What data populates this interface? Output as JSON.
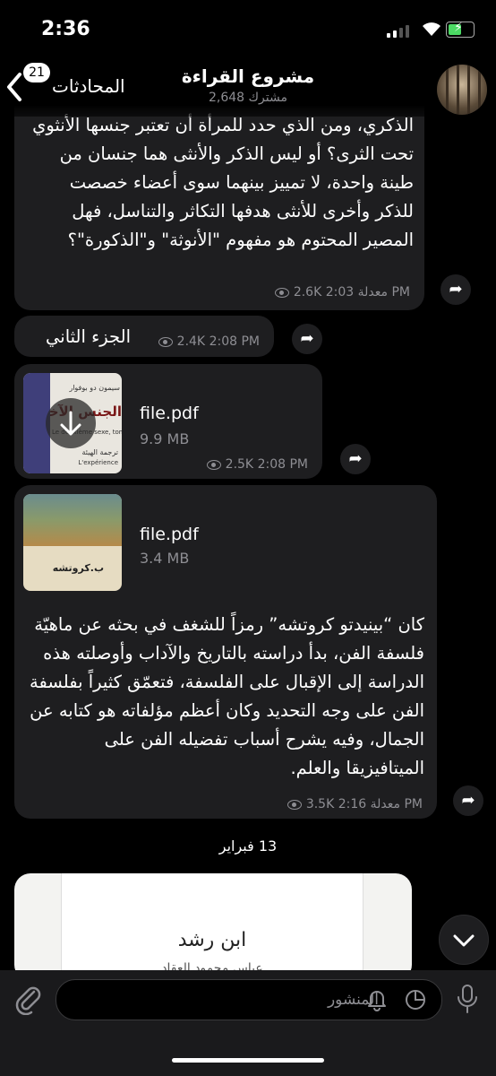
{
  "status": {
    "time": "2:36"
  },
  "header": {
    "back_label": "المحادثات",
    "unread_count": "21",
    "title": "مشروع القراءة",
    "subscribers": "2,648 مشترك"
  },
  "messages": [
    {
      "text": "الذكري، ومن الذي حدد للمرأة أن تعتبر جنسها الأنثوي تحت الثرى؟ أو ليس الذكر والأنثى هما جنسان من طينة واحدة، لا تمييز بينهما سوى أعضاء خصصت للذكر وأخرى للأنثى هدفها التكاثر والتناسل، فهل المصير المحتوم هو مفهوم \"الأنوثة\" و\"الذكورة\"؟",
      "views": "2.6K",
      "time": "2:03 PM",
      "edited": "معدلة"
    },
    {
      "text": "الجزء الثاني",
      "views": "2.4K",
      "time": "2:08 PM"
    },
    {
      "file_name": "file.pdf",
      "file_size": "9.9 MB",
      "views": "2.5K",
      "time": "2:08 PM",
      "cover_title": "الجنس الآخر",
      "cover_author": "سيمون دو بوفوار",
      "cover_subtitle": "Le deuxième sexe, tome",
      "cover_line2": "ترجمة الهيئة",
      "cover_line3": "L'expérience"
    },
    {
      "file_name": "file.pdf",
      "file_size": "3.4 MB",
      "cover_title": "ب.كروتشه",
      "text": "كان “بينيدتو كروتشه” رمزاً للشغف في بحثه عن ماهيّة فلسفة الفن، بدأ دراسته بالتاريخ والآداب وأوصلته هذه الدراسة إلى الإقبال على الفلسفة، فتعمّق كثيراً بفلسفة الفن على وجه التحديد وكان أعظم مؤلفاته هو كتابه عن الجمال، وفيه يشرح أسباب تفضيله الفن على الميتافيزيقا والعلم.",
      "views": "3.5K",
      "time": "2:16 PM",
      "edited": "معدلة"
    }
  ],
  "date_separator": "13 فبراير",
  "book_preview": {
    "title": "ابن رشد",
    "author": "عباس محمود العقاد"
  },
  "composer": {
    "placeholder": "المنشور"
  }
}
